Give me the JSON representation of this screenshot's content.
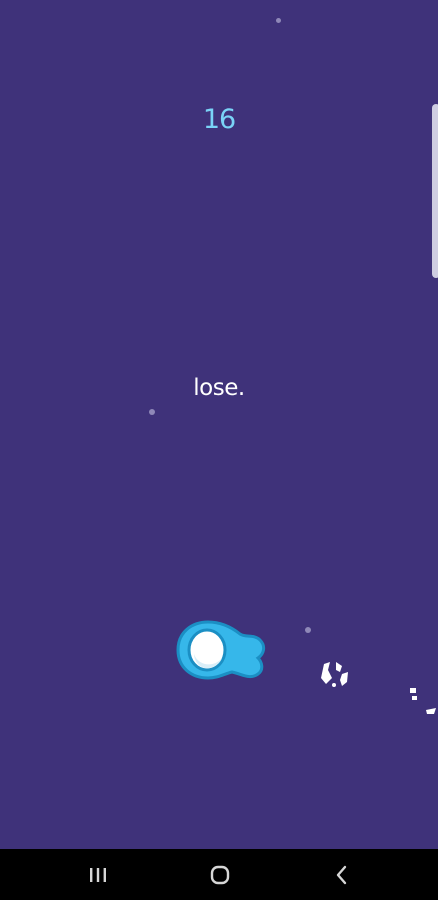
{
  "colors": {
    "background": "#3f327a",
    "score": "#7ad3f7",
    "message": "#ffffff",
    "star": "#8f88b8",
    "player_body": "#36b7ea",
    "player_outline": "#1b8fc4",
    "player_visor": "#ffffff",
    "navbar": "#000000",
    "nav_icon": "#d6d6d6",
    "scrollbar": "#cfcde2",
    "debris": "#ffffff"
  },
  "hud": {
    "score": "16"
  },
  "game": {
    "message": "lose."
  },
  "icons": {
    "player": "blue-astronaut-icon",
    "debris": "asteroid-fragment-icon",
    "nav_recents": "recent-apps-icon",
    "nav_home": "home-icon",
    "nav_back": "back-icon"
  }
}
